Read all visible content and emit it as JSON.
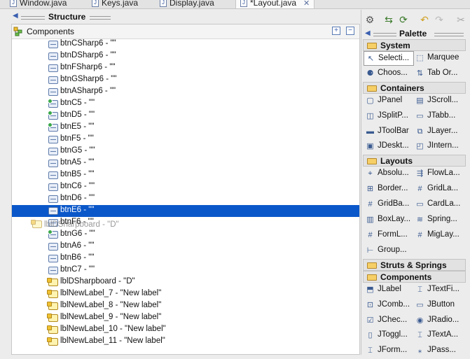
{
  "tabs": [
    {
      "name": "Window.java",
      "active": false
    },
    {
      "name": "Keys.java",
      "active": false
    },
    {
      "name": "Display.java",
      "active": false
    },
    {
      "name": "*Layout.java",
      "active": true
    }
  ],
  "structure": {
    "title": "Structure",
    "root_label": "Components",
    "rows": [
      {
        "text": "btnCSharp6 - \"\"",
        "icon": "button-icon",
        "selected": false
      },
      {
        "text": "btnDSharp6 - \"\"",
        "icon": "button-icon",
        "selected": false
      },
      {
        "text": "btnFSharp6 - \"\"",
        "icon": "button-icon",
        "selected": false
      },
      {
        "text": "btnGSharp6 - \"\"",
        "icon": "button-icon",
        "selected": false
      },
      {
        "text": "btnASharp6 - \"\"",
        "icon": "button-icon",
        "selected": false
      },
      {
        "text": "btnC5 - \"\"",
        "icon": "button-green-icon",
        "selected": false
      },
      {
        "text": "btnD5 - \"\"",
        "icon": "button-green-icon",
        "selected": false
      },
      {
        "text": "btnE5 - \"\"",
        "icon": "button-green-icon",
        "selected": false
      },
      {
        "text": "btnF5 - \"\"",
        "icon": "button-icon",
        "selected": false
      },
      {
        "text": "btnG5 - \"\"",
        "icon": "button-icon",
        "selected": false
      },
      {
        "text": "btnA5 - \"\"",
        "icon": "button-icon",
        "selected": false
      },
      {
        "text": "btnB5 - \"\"",
        "icon": "button-icon",
        "selected": false
      },
      {
        "text": "btnC6 - \"\"",
        "icon": "button-icon",
        "selected": false
      },
      {
        "text": "btnD6 - \"\"",
        "icon": "button-icon",
        "selected": false
      },
      {
        "text": "btnE6 - \"\"",
        "icon": "button-icon",
        "selected": true
      },
      {
        "text": "btnF6 - \"\"",
        "icon": "button-icon",
        "selected": false
      },
      {
        "text": "btnG6 - \"\"",
        "icon": "button-green-icon",
        "selected": false
      },
      {
        "text": "btnA6 - \"\"",
        "icon": "button-icon",
        "selected": false
      },
      {
        "text": "btnB6 - \"\"",
        "icon": "button-icon",
        "selected": false
      },
      {
        "text": "btnC7 - \"\"",
        "icon": "button-icon",
        "selected": false
      },
      {
        "text": "lblDSharpboard - \"D\"",
        "icon": "label-icon",
        "selected": false
      },
      {
        "text": "lblNewLabel_7 - \"New label\"",
        "icon": "label-icon",
        "selected": false
      },
      {
        "text": "lblNewLabel_8 - \"New label\"",
        "icon": "label-icon",
        "selected": false
      },
      {
        "text": "lblNewLabel_9 - \"New label\"",
        "icon": "label-icon",
        "selected": false
      },
      {
        "text": "lblNewLabel_10 - \"New label\"",
        "icon": "label-icon",
        "selected": false
      },
      {
        "text": "lblNewLabel_11 - \"New label\"",
        "icon": "label-icon",
        "selected": false
      }
    ],
    "drag_ghost": "lblDSharpboard - \"D\""
  },
  "palette": {
    "title": "Palette",
    "categories": [
      {
        "name": "System",
        "items": [
          {
            "label": "Selecti...",
            "icon": "arrow-cursor-icon",
            "glyph": "↖",
            "selected": true
          },
          {
            "label": "Marquee",
            "icon": "marquee-icon",
            "glyph": "⬚",
            "selected": false
          },
          {
            "label": "Choos...",
            "icon": "bean-icon",
            "glyph": "⚈",
            "selected": false
          },
          {
            "label": "Tab Or...",
            "icon": "tab-order-icon",
            "glyph": "⇅",
            "selected": false
          }
        ]
      },
      {
        "name": "Containers",
        "items": [
          {
            "label": "JPanel",
            "icon": "panel-icon",
            "glyph": "▢",
            "selected": false
          },
          {
            "label": "JScroll...",
            "icon": "scrollpane-icon",
            "glyph": "▤",
            "selected": false
          },
          {
            "label": "JSplitP...",
            "icon": "splitpane-icon",
            "glyph": "◫",
            "selected": false
          },
          {
            "label": "JTabb...",
            "icon": "tabbedpane-icon",
            "glyph": "▭",
            "selected": false
          },
          {
            "label": "JToolBar",
            "icon": "toolbar-icon",
            "glyph": "▬",
            "selected": false
          },
          {
            "label": "JLayer...",
            "icon": "layeredpane-icon",
            "glyph": "⧉",
            "selected": false
          },
          {
            "label": "JDeskt...",
            "icon": "desktoppane-icon",
            "glyph": "▣",
            "selected": false
          },
          {
            "label": "JIntern...",
            "icon": "internalframe-icon",
            "glyph": "◰",
            "selected": false
          }
        ]
      },
      {
        "name": "Layouts",
        "items": [
          {
            "label": "Absolu...",
            "icon": "absolute-layout-icon",
            "glyph": "⌖",
            "selected": false
          },
          {
            "label": "FlowLa...",
            "icon": "flowlayout-icon",
            "glyph": "⇶",
            "selected": false
          },
          {
            "label": "Border...",
            "icon": "borderlayout-icon",
            "glyph": "⊞",
            "selected": false
          },
          {
            "label": "GridLa...",
            "icon": "gridlayout-icon",
            "glyph": "#",
            "selected": false
          },
          {
            "label": "GridBa...",
            "icon": "gridbaglayout-icon",
            "glyph": "#",
            "selected": false
          },
          {
            "label": "CardLa...",
            "icon": "cardlayout-icon",
            "glyph": "▭",
            "selected": false
          },
          {
            "label": "BoxLay...",
            "icon": "boxlayout-icon",
            "glyph": "▥",
            "selected": false
          },
          {
            "label": "Spring...",
            "icon": "springlayout-icon",
            "glyph": "≋",
            "selected": false
          },
          {
            "label": "FormL...",
            "icon": "formlayout-icon",
            "glyph": "#",
            "selected": false
          },
          {
            "label": "MigLay...",
            "icon": "miglayout-icon",
            "glyph": "#",
            "selected": false
          },
          {
            "label": "Group...",
            "icon": "grouplayout-icon",
            "glyph": "⊢",
            "selected": false
          }
        ]
      },
      {
        "name": "Struts & Springs",
        "items": []
      },
      {
        "name": "Components",
        "items": [
          {
            "label": "JLabel",
            "icon": "jlabel-icon",
            "glyph": "⬒",
            "selected": false
          },
          {
            "label": "JTextFi...",
            "icon": "textfield-icon",
            "glyph": "⌶",
            "selected": false
          },
          {
            "label": "JComb...",
            "icon": "combobox-icon",
            "glyph": "⊡",
            "selected": false
          },
          {
            "label": "JButton",
            "icon": "jbutton-icon",
            "glyph": "▭",
            "selected": false
          },
          {
            "label": "JChec...",
            "icon": "checkbox-icon",
            "glyph": "☑",
            "selected": false
          },
          {
            "label": "JRadio...",
            "icon": "radio-icon",
            "glyph": "◉",
            "selected": false
          },
          {
            "label": "JToggl...",
            "icon": "togglebutton-icon",
            "glyph": "▯",
            "selected": false
          },
          {
            "label": "JTextA...",
            "icon": "textarea-icon",
            "glyph": "⌶",
            "selected": false
          },
          {
            "label": "JForm...",
            "icon": "formattedfield-icon",
            "glyph": "⌶",
            "selected": false
          },
          {
            "label": "JPass...",
            "icon": "passwordfield-icon",
            "glyph": "⁎",
            "selected": false
          }
        ]
      }
    ]
  }
}
